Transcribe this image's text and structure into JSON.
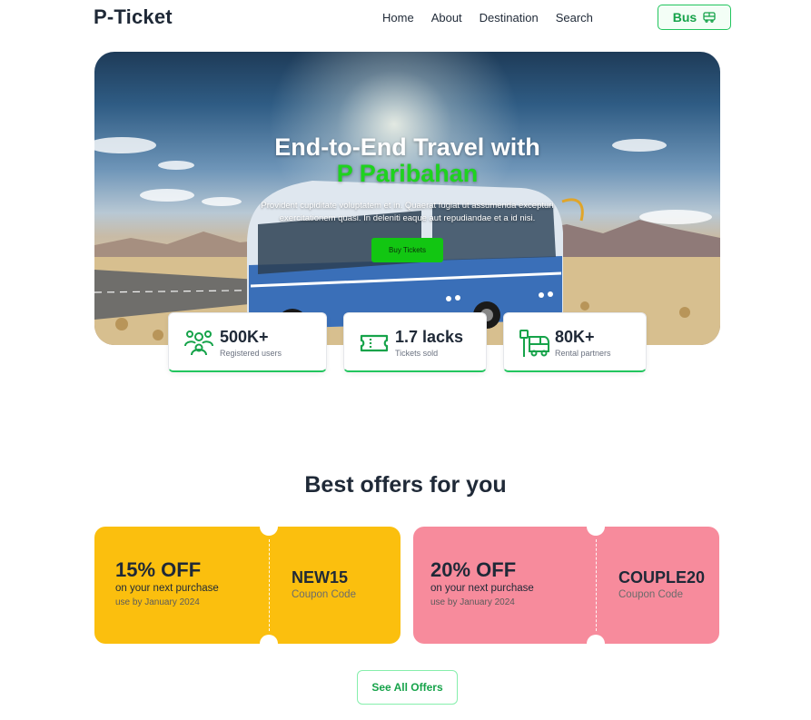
{
  "nav": {
    "logo": "P-Ticket",
    "links": [
      "Home",
      "About",
      "Destination",
      "Search"
    ],
    "bus_label": "Bus"
  },
  "hero": {
    "title_line1": "End-to-End Travel with",
    "title_line2": "P Paribahan",
    "description": "Provident cupiditate voluptatem et in. Quaerat fugiat ut assumenda excepturi exercitationem quasi. In deleniti eaque aut repudiandae et a id nisi.",
    "cta_label": "Buy Tickets"
  },
  "stats": [
    {
      "value": "500K+",
      "label": "Registered users",
      "icon": "users-icon"
    },
    {
      "value": "1.7 lacks",
      "label": "Tickets sold",
      "icon": "ticket-icon"
    },
    {
      "value": "80K+",
      "label": "Rental partners",
      "icon": "bus-stop-icon"
    }
  ],
  "offers": {
    "title": "Best offers for you",
    "coupons": [
      {
        "discount": "15% OFF",
        "line1": "on your next purchase",
        "line2": "use by January 2024",
        "code": "NEW15",
        "code_label": "Coupon Code",
        "color": "#fbbf0e"
      },
      {
        "discount": "20% OFF",
        "line1": "on your next purchase",
        "line2": "use by January 2024",
        "code": "COUPLE20",
        "code_label": "Coupon Code",
        "color": "#f78b9c"
      }
    ],
    "see_all_label": "See All Offers"
  },
  "colors": {
    "accent": "#22c55e",
    "hero_accent": "#1ed31e",
    "text_dark": "#1f2937"
  }
}
